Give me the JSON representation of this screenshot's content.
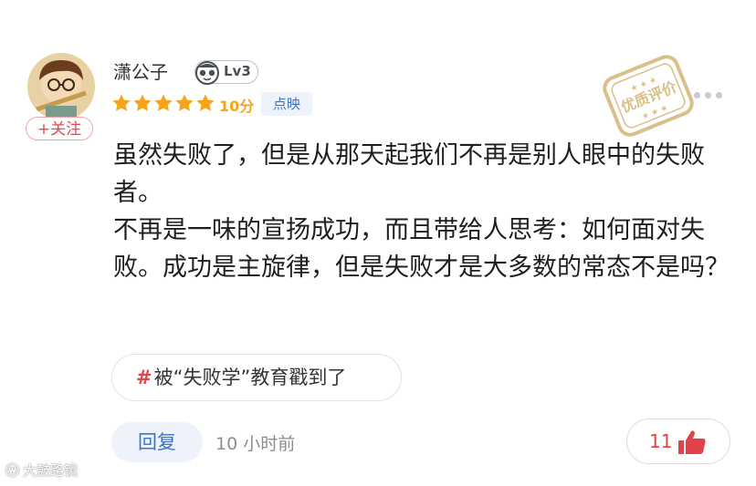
{
  "user": {
    "name": "潇公子",
    "level": "Lv3",
    "follow_label": "+关注"
  },
  "rating": {
    "stars": 5,
    "score": "10分",
    "source": "点映",
    "star_color": "#f6a51b"
  },
  "stamp": {
    "text": "优质评价",
    "color": "#d9c08a"
  },
  "review": {
    "paragraph1": "虽然失败了，但是从那天起我们不再是别人眼中的失败者。",
    "paragraph2": "不再是一味的宣扬成功，而且带给人思考：如何面对失败。成功是主旋律，但是失败才是大多数的常态不是吗？"
  },
  "topic": {
    "hash": "#",
    "label": "被“失败学”教育戳到了"
  },
  "actions": {
    "reply_label": "回复",
    "time": "10 小时前",
    "like_count": "11",
    "accent_color": "#e2434b"
  },
  "watermark": {
    "text": "大鼓路镜"
  },
  "icons": {
    "more": "more-dots-icon",
    "like": "thumbs-up-icon",
    "level": "level-badge-icon"
  }
}
